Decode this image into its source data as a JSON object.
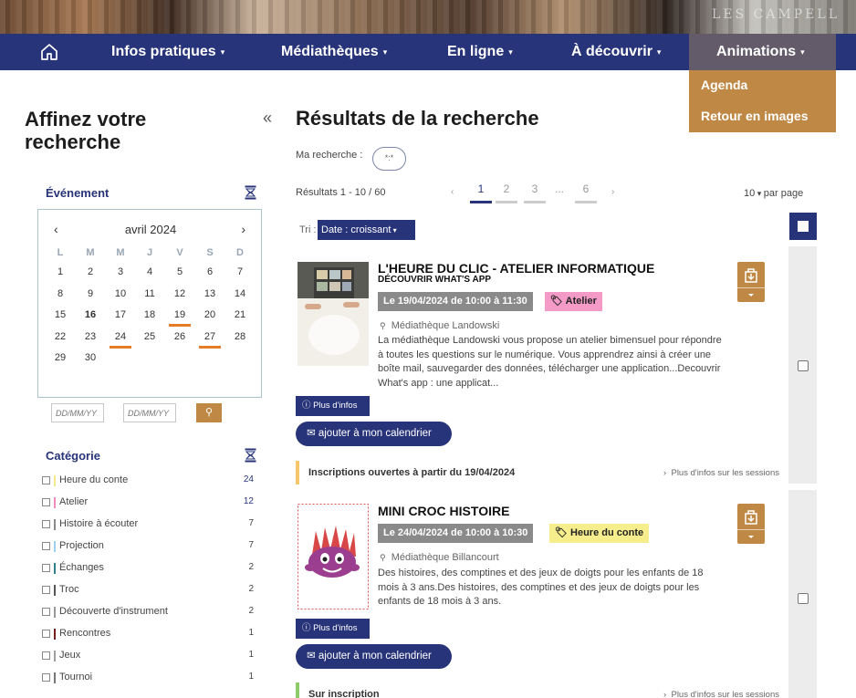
{
  "nav": {
    "items": [
      "Infos pratiques",
      "Médiathèques",
      "En ligne",
      "À découvrir",
      "Animations"
    ],
    "dropdown": [
      "Agenda",
      "Retour en images"
    ]
  },
  "sidebar": {
    "title": "Affinez votre recherche",
    "evenement_title": "Événement",
    "calendar": {
      "month": "avril 2024",
      "dow": [
        "L",
        "M",
        "M",
        "J",
        "V",
        "S",
        "D"
      ],
      "weeks": [
        [
          "1",
          "2",
          "3",
          "4",
          "5",
          "6",
          "7"
        ],
        [
          "8",
          "9",
          "10",
          "11",
          "12",
          "13",
          "14"
        ],
        [
          "15",
          "16",
          "17",
          "18",
          "19",
          "20",
          "21"
        ],
        [
          "22",
          "23",
          "24",
          "25",
          "26",
          "27",
          "28"
        ],
        [
          "29",
          "30"
        ]
      ],
      "today": "16",
      "event_days": [
        "19",
        "24",
        "27"
      ]
    },
    "date_from_placeholder": "DD/MM/YY",
    "date_to_placeholder": "DD/MM/YY",
    "categorie_title": "Catégorie",
    "categories": [
      {
        "label": "Heure du conte",
        "count": "24",
        "color": "#f5e98a"
      },
      {
        "label": "Atelier",
        "count": "12",
        "color": "#f08cc0"
      },
      {
        "label": "Histoire à écouter",
        "count": "7",
        "color": "#8a8a8a"
      },
      {
        "label": "Projection",
        "count": "7",
        "color": "#9ccff0"
      },
      {
        "label": "Échanges",
        "count": "2",
        "color": "#2f7f8c"
      },
      {
        "label": "Troc",
        "count": "2",
        "color": "#555555"
      },
      {
        "label": "Découverte d'instrument",
        "count": "2",
        "color": "#999999"
      },
      {
        "label": "Rencontres",
        "count": "1",
        "color": "#7a1f1f"
      },
      {
        "label": "Jeux",
        "count": "1",
        "color": "#a0a0a0"
      },
      {
        "label": "Tournoi",
        "count": "1",
        "color": "#777777"
      }
    ]
  },
  "main": {
    "title": "Résultats de la recherche",
    "ma_recherche_label": "Ma recherche :",
    "ma_recherche_value": "*:*",
    "results_count": "Résultats 1 - 10 / 60",
    "pages": [
      "1",
      "2",
      "3",
      "...",
      "6"
    ],
    "prev": "‹",
    "next": "›",
    "per_page_value": "10",
    "per_page_label": "par page",
    "tri_label": "Tri :",
    "tri_value": "Date : croissant",
    "results": [
      {
        "title": "L'HEURE DU CLIC - ATELIER INFORMATIQUE",
        "subtitle": "DÉCOUVRIR WHAT'S APP",
        "date": "Le 19/04/2024 de 10:00 à 11:30",
        "tag": "Atelier",
        "tag_color": "#f39ac7",
        "place": "Médiathèque Landowski",
        "description": "La médiathèque Landowski vous propose un atelier bimensuel pour répondre à toutes les questions sur le numérique. Vous apprendrez ainsi à créer une boîte mail, sauvegarder des données, télécharger une application...Decouvrir What's app : une applicat...",
        "more_info": "Plus d'infos",
        "add_calendar": "ajouter à mon calendrier",
        "inscription": "Inscriptions ouvertes à partir du 19/04/2024",
        "inscription_color": "#f5c66a",
        "sessions_link": "Plus d'infos sur les sessions"
      },
      {
        "title": "MINI CROC HISTOIRE",
        "date": "Le 24/04/2024 de 10:00 à 10:30",
        "tag": "Heure du conte",
        "tag_color": "#f6ee8c",
        "place": "Médiathèque Billancourt",
        "description": "Des histoires, des comptines et des jeux de doigts pour les enfants de 18 mois à 3 ans.Des histoires, des comptines et des jeux de doigts pour les enfants de 18 mois à 3 ans.",
        "more_info": "Plus d'infos",
        "add_calendar": "ajouter à mon calendrier",
        "inscription": "Sur inscription",
        "inscription_color": "#8fcb6a",
        "sessions_link": "Plus d'infos sur les sessions"
      }
    ]
  }
}
